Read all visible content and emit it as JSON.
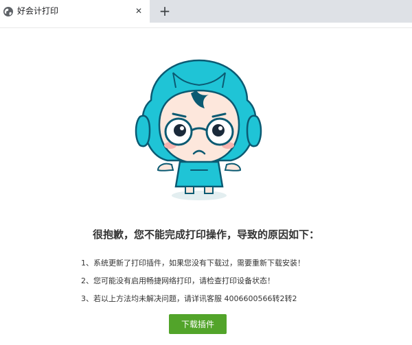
{
  "tab": {
    "title": "好会计打印",
    "favicon": "globe-icon",
    "close_glyph": "✕",
    "new_tab_glyph": "+"
  },
  "page": {
    "headline": "很抱歉，您不能完成打印操作，导致的原因如下：",
    "reasons": [
      "1、系统更新了打印插件，如果您没有下载过，需要重新下载安装！",
      "2、您可能没有启用畅捷网络打印，请检查打印设备状态！",
      "3、若以上方法均未解决问题，请详讯客服 4006600566转2转2"
    ],
    "download_button": "下载插件",
    "mascot": "confused-mascot-illustration"
  },
  "colors": {
    "accent_button": "#52a42a",
    "mascot_hood": "#1fc4d6",
    "text": "#333333"
  }
}
